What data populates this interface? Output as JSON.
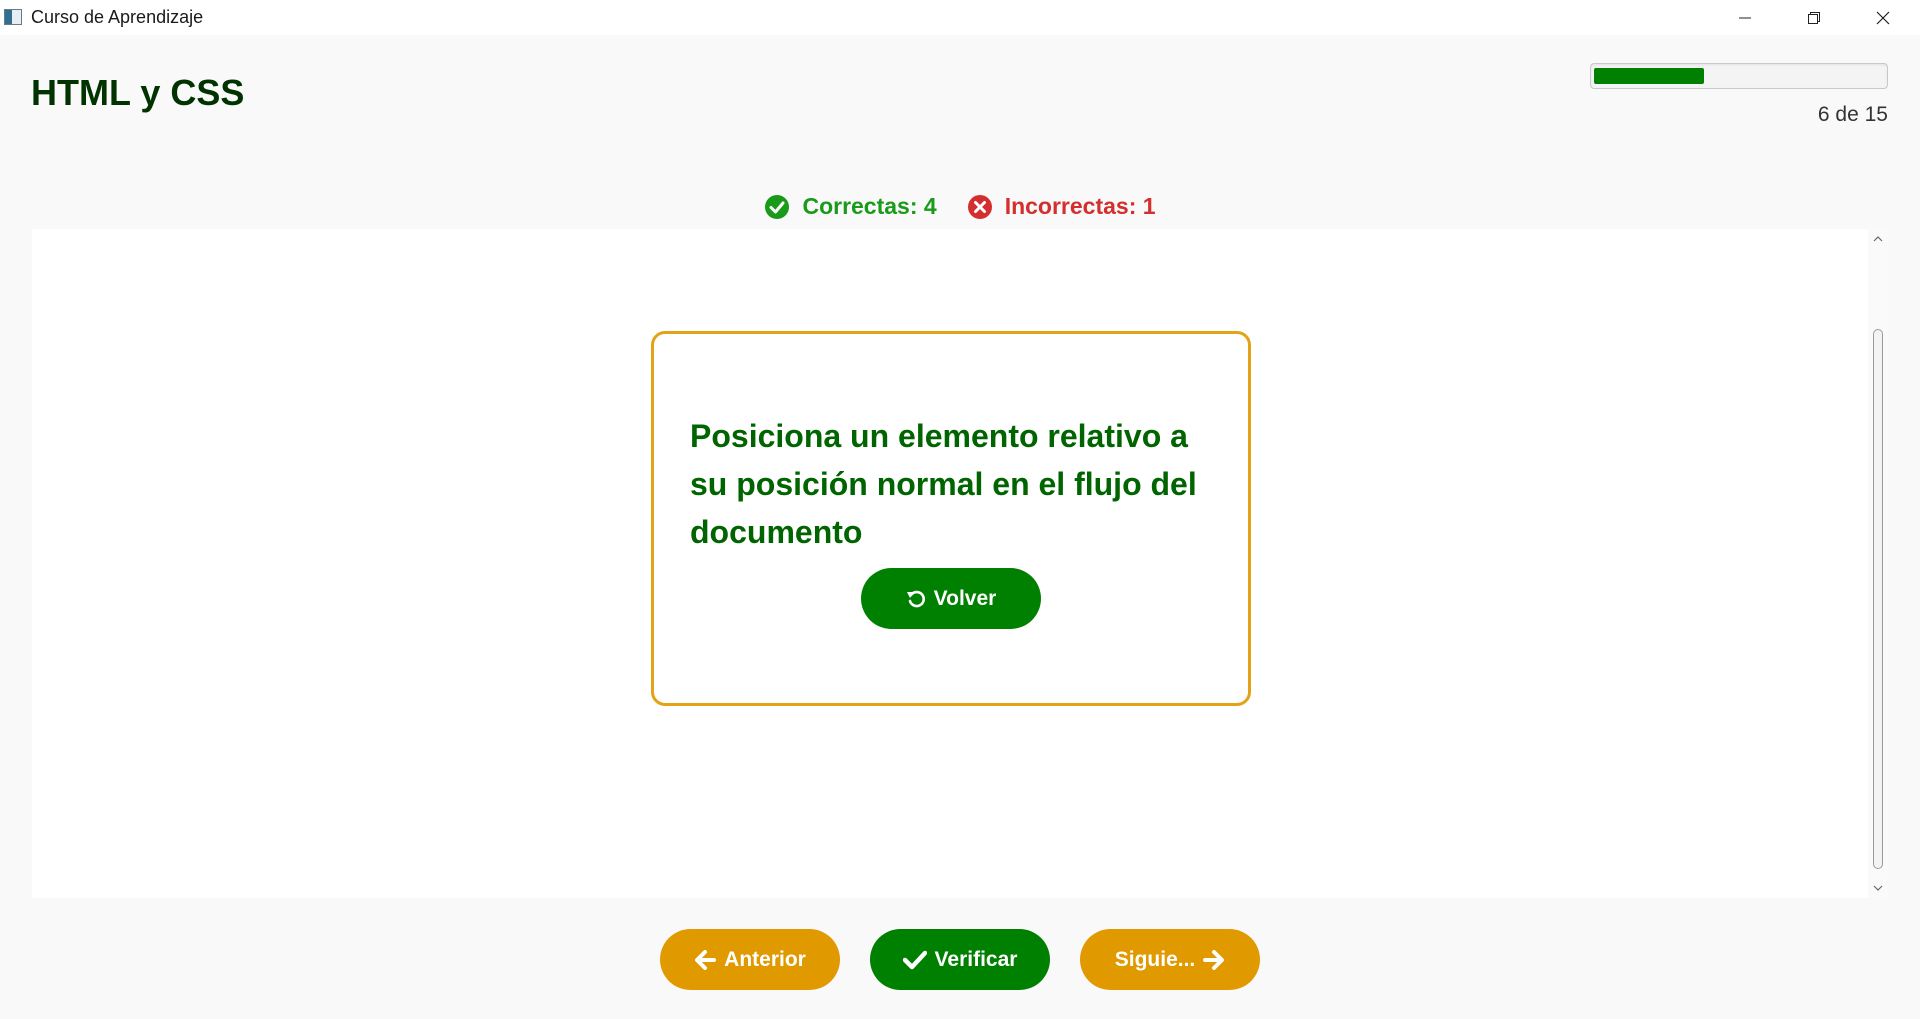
{
  "window": {
    "title": "Curso de Aprendizaje",
    "controls": [
      "minimize-icon",
      "restore-icon",
      "close-icon"
    ]
  },
  "header": {
    "title": "HTML y CSS",
    "progress": {
      "current": 6,
      "total": 15,
      "fraction": 0.38,
      "label": "6 de 15"
    }
  },
  "score": {
    "correct_label": "Correctas: 4",
    "incorrect_label": "Incorrectas: 1",
    "correct_icon": "check-circle-icon",
    "incorrect_icon": "x-circle-icon"
  },
  "card": {
    "text": "Posiciona un elemento relativo a su posición normal en el flujo del documento",
    "back_button_label": "Volver",
    "back_button_icon": "rotate-left-icon"
  },
  "navigation": {
    "previous_label": "Anterior",
    "previous_icon": "arrow-left-icon",
    "verify_label": "Verificar",
    "verify_icon": "check-icon",
    "next_label": "Siguie...",
    "next_icon": "arrow-right-icon"
  },
  "colors": {
    "primary_green": "#008000",
    "accent_orange": "#e09a00",
    "card_border": "#e3a317",
    "correct": "#1a9a1a",
    "incorrect": "#d32f2f",
    "title": "#003300"
  }
}
